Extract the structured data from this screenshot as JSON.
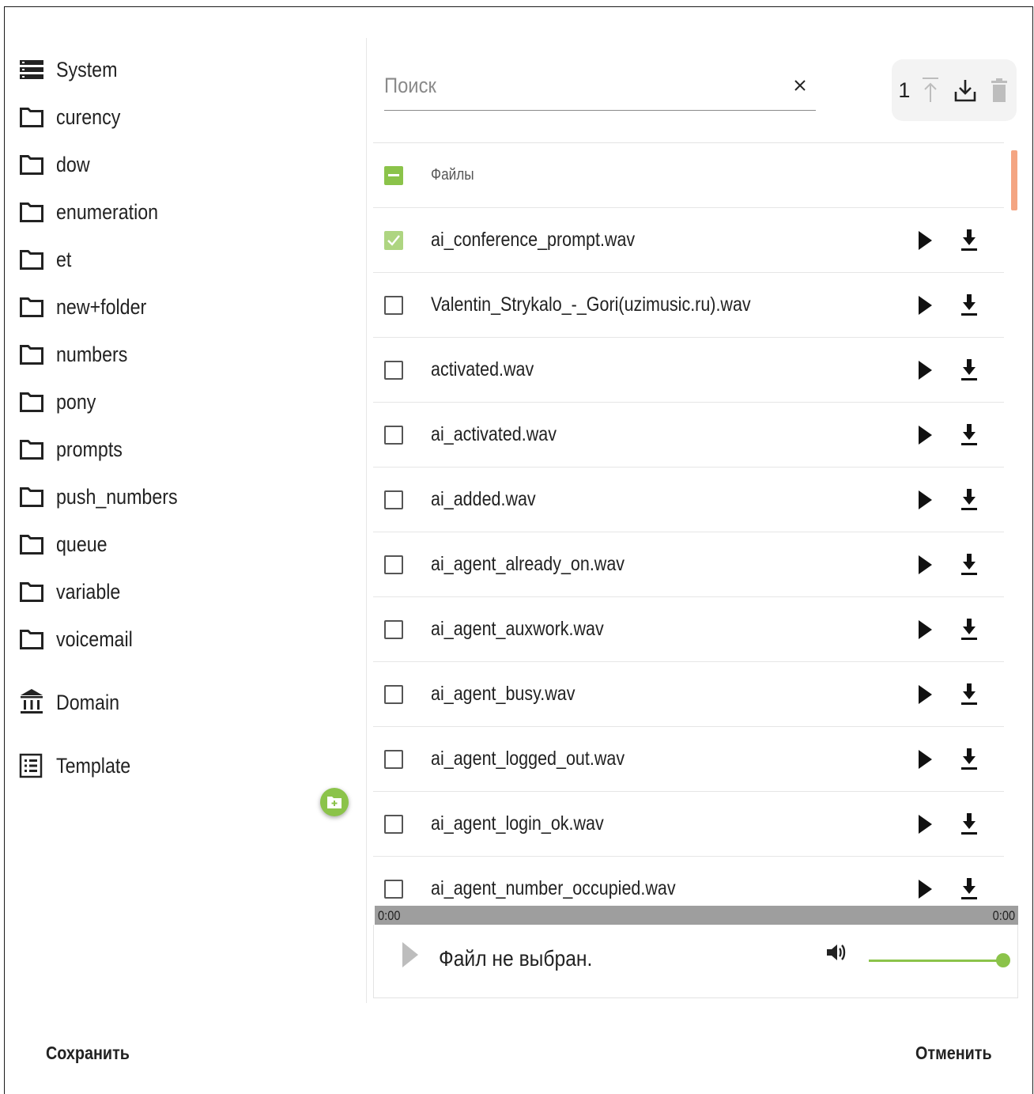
{
  "sidebar": {
    "items": [
      {
        "label": "System",
        "icon": "storage-icon"
      },
      {
        "label": "curency",
        "icon": "folder-icon"
      },
      {
        "label": "dow",
        "icon": "folder-icon"
      },
      {
        "label": "enumeration",
        "icon": "folder-icon"
      },
      {
        "label": "et",
        "icon": "folder-icon"
      },
      {
        "label": "new+folder",
        "icon": "folder-icon"
      },
      {
        "label": "numbers",
        "icon": "folder-icon"
      },
      {
        "label": "pony",
        "icon": "folder-icon"
      },
      {
        "label": "prompts",
        "icon": "folder-icon"
      },
      {
        "label": "push_numbers",
        "icon": "folder-icon"
      },
      {
        "label": "queue",
        "icon": "folder-icon"
      },
      {
        "label": "variable",
        "icon": "folder-icon"
      },
      {
        "label": "voicemail",
        "icon": "folder-icon"
      },
      {
        "label": "Domain",
        "icon": "bank-icon"
      },
      {
        "label": "Template",
        "icon": "list-icon"
      }
    ],
    "add_folder_icon": "create-new-folder-icon"
  },
  "search": {
    "placeholder": "Поиск",
    "value": "",
    "clear_icon": "close-icon"
  },
  "toolbar": {
    "count": "1",
    "upload_icon": "upload-icon",
    "download_icon": "download-tray-icon",
    "delete_icon": "trash-icon"
  },
  "file_list": {
    "header_label": "Файлы",
    "files": [
      {
        "name": "ai_conference_prompt.wav",
        "checked": true
      },
      {
        "name": "Valentin_Strykalo_-_Gori(uzimusic.ru).wav",
        "checked": false
      },
      {
        "name": "activated.wav",
        "checked": false
      },
      {
        "name": "ai_activated.wav",
        "checked": false
      },
      {
        "name": "ai_added.wav",
        "checked": false
      },
      {
        "name": "ai_agent_already_on.wav",
        "checked": false
      },
      {
        "name": "ai_agent_auxwork.wav",
        "checked": false
      },
      {
        "name": "ai_agent_busy.wav",
        "checked": false
      },
      {
        "name": "ai_agent_logged_out.wav",
        "checked": false
      },
      {
        "name": "ai_agent_login_ok.wav",
        "checked": false
      },
      {
        "name": "ai_agent_number_occupied.wav",
        "checked": false
      }
    ]
  },
  "player": {
    "time_start": "0:00",
    "time_end": "0:00",
    "status": "Файл не выбран.",
    "volume": 1.0
  },
  "footer": {
    "save_label": "Сохранить",
    "cancel_label": "Отменить"
  },
  "colors": {
    "accent": "#8bc34a",
    "accent_light": "#aed581",
    "scrollbar": "#f4a582",
    "seek_bar": "#9e9e9e"
  }
}
